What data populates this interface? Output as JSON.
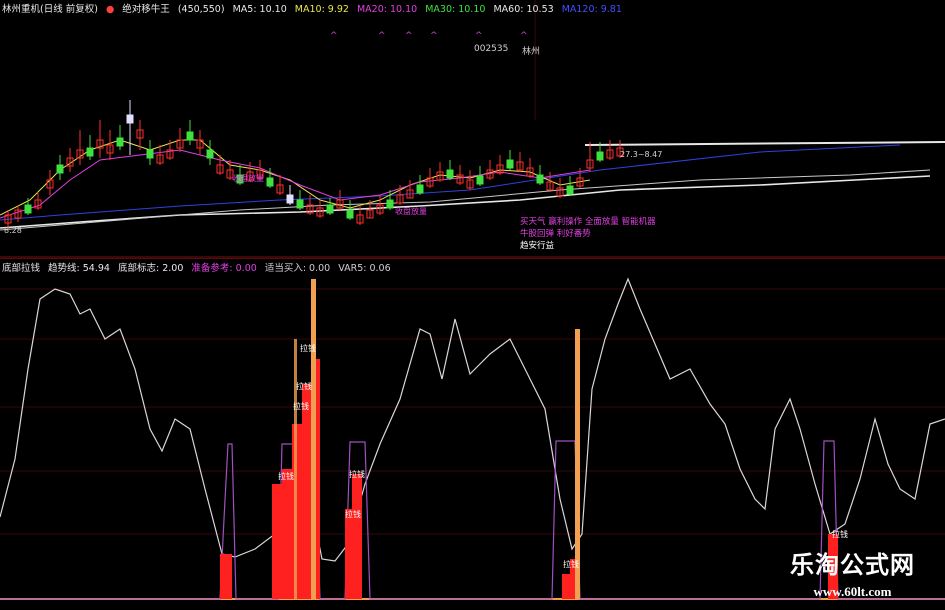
{
  "upper_legend": {
    "stock": "林州重机(日线 前复权)",
    "indicator": "绝对移牛王",
    "params": "(450,550)",
    "ma5": "MA5: 10.10",
    "ma10": "MA10: 9.92",
    "ma20": "MA20: 10.10",
    "ma30": "MA30: 10.10",
    "ma60": "MA60: 10.53",
    "ma_hidden": "MA120: 9.81"
  },
  "chart_labels": {
    "code": "002535",
    "name": "林州",
    "low_price": "8.28",
    "right_price": "27.3~8.47",
    "tag1": "买天气 赢利操作 全面放量 智能机器",
    "tag2": "牛股回弹 利好番势",
    "tag3": "趋安行益",
    "mid_tag1": "收盘放量",
    "mid_tag2": "收盘放量"
  },
  "lower_legend": {
    "l1": "底部拉钱",
    "l2": "趋势线: 54.94",
    "l3": "底部标志: 2.00",
    "l4": "准备参考: 0.00",
    "l5": "适当买入: 0.00",
    "l6": "VAR5: 0.06"
  },
  "signal_label": "拉钱",
  "watermark": {
    "title": "乐淘公式网",
    "url": "www.60lt.com"
  },
  "colors": {
    "bg": "#000000",
    "line_white": "#d8d8d8",
    "red_bar": "#ff2020",
    "orange": "#f0a050",
    "purple": "#a050c0",
    "label_magenta": "#e040e0",
    "legend_yellow": "#e8e850"
  }
}
